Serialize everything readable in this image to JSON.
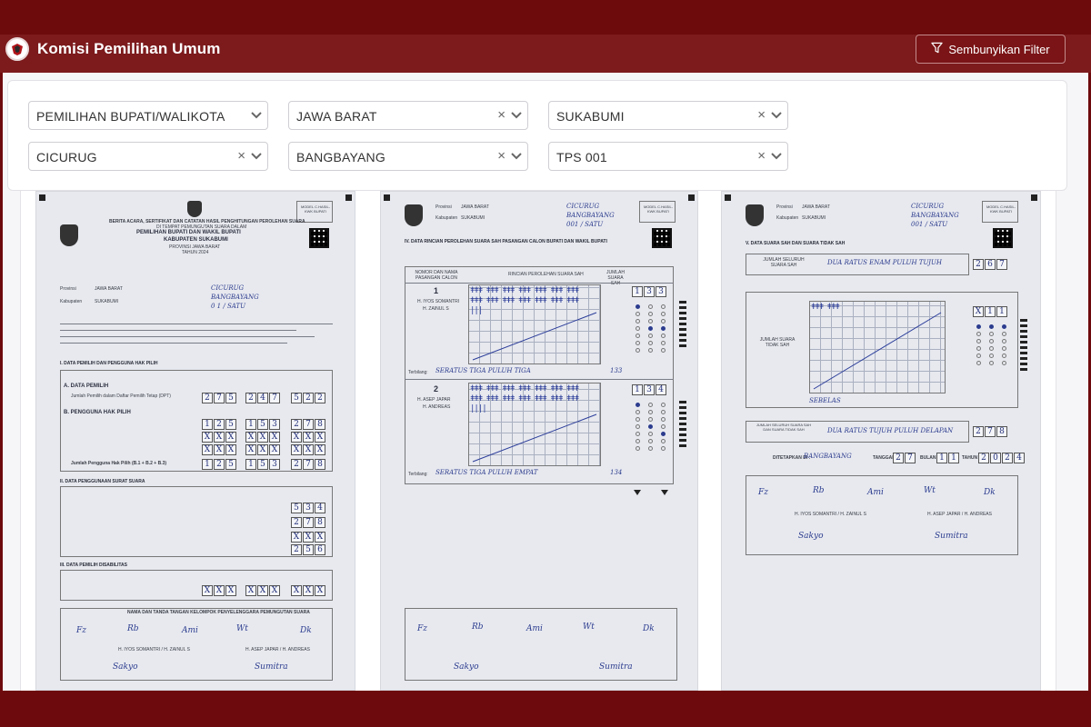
{
  "app": {
    "title": "Komisi Pemilihan Umum",
    "filter_button_label": "Sembunyikan Filter"
  },
  "filters": {
    "election_type": "PEMILIHAN BUPATI/WALIKOTA",
    "province": "JAWA BARAT",
    "regency": "SUKABUMI",
    "district": "CICURUG",
    "village": "BANGBAYANG",
    "polling_station": "TPS 001",
    "clear_symbol": "×"
  },
  "documents": {
    "page1": {
      "model": "MODEL C.HASIL-KWK BUPATI",
      "header1": "BERITA ACARA, SERTIFIKAT DAN CATATAN HASIL PENGHITUNGAN PEROLEHAN SUARA",
      "header2": "DI TEMPAT PEMUNGUTAN SUARA DALAM",
      "header3": "PEMILIHAN BUPATI DAN WAKIL BUPATI",
      "header4": "KABUPATEN SUKABUMI",
      "header5": "PROVINSI JAWA BARAT",
      "header6": "TAHUN 2024",
      "province_label": "Provinsi",
      "province_value": "JAWA BARAT",
      "regency_label": "Kabupaten",
      "regency_value": "SUKABUMI",
      "district_hand": "CICURUG",
      "village_hand": "BANGBAYANG",
      "tps_hand": "0 1 / SATU",
      "section_i": "I.   DATA PEMILIH DAN PENGGUNA HAK PILIH",
      "section_ii": "II.   DATA PENGGUNAAN SURAT SUARA",
      "section_iii": "III.   DATA PEMILIH DISABILITAS",
      "data_pemilih": "A.  DATA PEMILIH",
      "pengguna": "B.  PENGGUNA HAK PILIH",
      "dpt_label": "Jumlah Pemilih dalam Daftar Pemilih Tetap (DPT)",
      "total_label": "Jumlah Pengguna Hak Pilih (B.1 + B.2 + B.3)",
      "dpt_l": [
        "2",
        "7",
        "5"
      ],
      "dpt_p": [
        "2",
        "4",
        "7"
      ],
      "dpt_lp": [
        "5",
        "2",
        "2"
      ],
      "b1_l": [
        "1",
        "2",
        "5"
      ],
      "b1_p": [
        "1",
        "5",
        "3"
      ],
      "b1_lp": [
        "2",
        "7",
        "8"
      ],
      "ss_received": [
        "5",
        "3",
        "4"
      ],
      "ss_used": [
        "2",
        "7",
        "8"
      ],
      "ss_unused": [
        "2",
        "5",
        "6"
      ],
      "sign_title": "NAMA DAN TANDA TANGAN KELOMPOK PENYELENGGARA PEMUNGUTAN SUARA",
      "candidate1": "H. IYOS SOMANTRI / H. ZAINUL S",
      "candidate2": "H. ASEP JAPAR / H. ANDREAS"
    },
    "page2": {
      "model": "MODEL C.HASIL-KWK BUPATI",
      "province_value": "JAWA BARAT",
      "regency_value": "SUKABUMI",
      "district_hand": "CICURUG",
      "village_hand": "BANGBAYANG",
      "tps_hand": "001 / SATU",
      "section_iv": "IV.   DATA RINCIAN PEROLEHAN SUARA SAH PASANGAN CALON BUPATI DAN WAKIL BUPATI",
      "col_candidate": "NOMOR DAN NAMA PASANGAN CALON",
      "col_tally": "RINCIAN PEROLEHAN SUARA SAH",
      "col_total": "JUMLAH SUARA SAH",
      "c1_num": "1",
      "c1_name1": "H. IYOS SOMANTRI",
      "c1_name2": "H. ZAINUL S",
      "c1_words": "SERATUS TIGA PULUH TIGA",
      "c1_digits": [
        "1",
        "3",
        "3"
      ],
      "c2_num": "2",
      "c2_name1": "H. ASEP JAPAR",
      "c2_name2": "H. ANDREAS",
      "c2_words": "SERATUS TIGA PULUH EMPAT",
      "c2_digits": [
        "1",
        "3",
        "4"
      ],
      "c1_sub": "133",
      "c2_sub": "134"
    },
    "page3": {
      "model": "MODEL C.HASIL-KWK BUPATI",
      "province_value": "JAWA BARAT",
      "regency_value": "SUKABUMI",
      "district_hand": "CICURUG",
      "village_hand": "BANGBAYANG",
      "tps_hand": "001 / SATU",
      "section_v": "V.   DATA SUARA SAH DAN SUARA TIDAK SAH",
      "a_label": "JUMLAH SELURUH SUARA SAH",
      "a_words": "DUA RATUS ENAM PULUH TUJUH",
      "a_digits": [
        "2",
        "6",
        "7"
      ],
      "b_label": "JUMLAH SUARA TIDAK SAH",
      "b_words": "SEBELAS",
      "b_digits": [
        "X",
        "1",
        "1"
      ],
      "c_label": "JUMLAH SELURUH SUARA SAH DAN SUARA TIDAK SAH",
      "c_words": "DUA RATUS TUJUH PULUH DELAPAN",
      "c_digits": [
        "2",
        "7",
        "8"
      ],
      "set_label": "DITETAPKAN DI :",
      "set_place": "BANGBAYANG",
      "date_label": "TANGGAL",
      "date_digits": [
        "2",
        "7"
      ],
      "month_label": "BULAN",
      "month_digits": [
        "1",
        "1"
      ],
      "year_label": "TAHUN",
      "year_digits": [
        "2",
        "0",
        "2",
        "4"
      ],
      "candidate1": "H. IYOS SOMANTRI / H. ZAINUL S",
      "candidate2": "H. ASEP JAPAR / H. ANDREAS"
    }
  }
}
